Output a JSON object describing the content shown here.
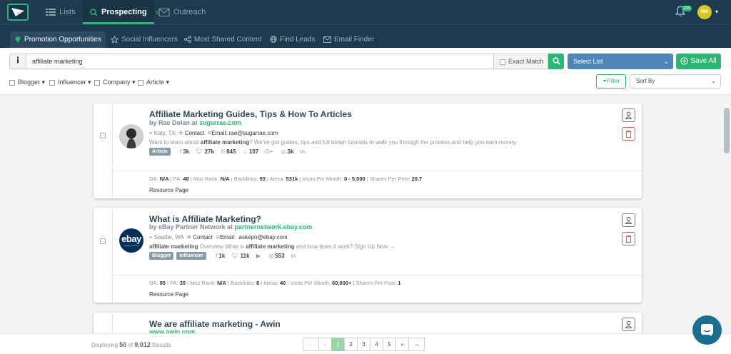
{
  "topnav": {
    "items": [
      {
        "label": "Lists",
        "icon": "list-icon"
      },
      {
        "label": "Prospecting",
        "icon": "search-icon"
      },
      {
        "label": "Outreach",
        "icon": "mail-icon"
      }
    ],
    "notification_count": "200",
    "avatar_initials": "NA"
  },
  "subnav": {
    "tabs": [
      {
        "label": "Promotion Opportunities",
        "icon": "diamond-icon"
      },
      {
        "label": "Social Influencers",
        "icon": "star-icon"
      },
      {
        "label": "Most Shared Content",
        "icon": "share-icon"
      },
      {
        "label": "Find Leads",
        "icon": "globe-icon"
      },
      {
        "label": "Email Finder",
        "icon": "envelope-icon"
      }
    ]
  },
  "toolbar": {
    "search_value": "affiliate marketing",
    "exact_match_label": "Exact Match",
    "select_list_label": "Select List",
    "save_all_label": "Save All",
    "filters": [
      "Blogger",
      "Influencer",
      "Company",
      "Article"
    ],
    "filter_button_label": "Filter",
    "sort_by_label": "Sort By"
  },
  "results": [
    {
      "title": "Affiliate Marketing Guides, Tips & How To Articles",
      "by_prefix": "by Rae Dolan at ",
      "site": "sugarrae.com",
      "location": "Katy, TX",
      "contact": "Contact",
      "email_label": "Email:",
      "email": "rae@sugarrae.com",
      "desc_pre": "Want to learn about ",
      "desc_bold": "affiliate marketing",
      "desc_post": "? We've got guides, tips and full blown tutorials to walk you through the process and help you earn money.",
      "tags": [
        "Article"
      ],
      "stats": {
        "facebook": "3k",
        "twitter": "27k",
        "pinterest": "845",
        "stumbleupon": "107",
        "googleplus": "G+",
        "instagram": "3k",
        "linkedin": "in"
      },
      "metrics": {
        "da": "N/A",
        "pa": "48",
        "moz": "N/A",
        "backlinks": "93",
        "alexa": "531k",
        "visits": "0 - 5,000",
        "shares": "20.7"
      },
      "resource": "Resource Page"
    },
    {
      "title": "What is Affiliate Marketing?",
      "by_prefix": "by eBay Partner Network at ",
      "site": "partnernetwork.ebay.com",
      "location": "Seattle, WA",
      "contact": "Contact",
      "email_label": "Email:",
      "email": "askepn@ebay.com",
      "desc_pre": "",
      "desc_bold": "affiliate marketing",
      "desc_mid": " Overview What is ",
      "desc_bold2": "affiliate marketing",
      "desc_post": " and how does it work? Sign Up Now →",
      "tags": [
        "Blogger",
        "Influencer"
      ],
      "stats": {
        "facebook": "1k",
        "twitter": "11k",
        "youtube": "",
        "instagram": "553",
        "linkedin": "in"
      },
      "metrics": {
        "da": "95",
        "pa": "35",
        "moz": "N/A",
        "backlinks": "8",
        "alexa": "40",
        "visits": "60,000+",
        "shares": "1"
      },
      "resource": "Resource Page",
      "logo_text": "ebay",
      "logo_sub": "partner network"
    },
    {
      "title": "We are affiliate marketing - Awin",
      "site": "www.awin.com"
    }
  ],
  "footer": {
    "displaying_prefix": "Displaying",
    "shown": "50",
    "of": "of",
    "total": "9,012",
    "suffix": "Results",
    "pages": [
      "1",
      "2",
      "3",
      "4",
      "5"
    ],
    "current_page": "1"
  },
  "metric_labels": {
    "da": "DA:",
    "pa": "PA:",
    "moz": "Moz Rank:",
    "backlinks": "Backlinks:",
    "alexa": "Alexa:",
    "visits": "Visits Per Month:",
    "shares": "Shares Per Post:"
  },
  "colors": {
    "nav_bg": "#1e3a4f",
    "accent_green": "#2bb673",
    "select_blue": "#4f86b8",
    "delete_red": "#e05c4b"
  }
}
